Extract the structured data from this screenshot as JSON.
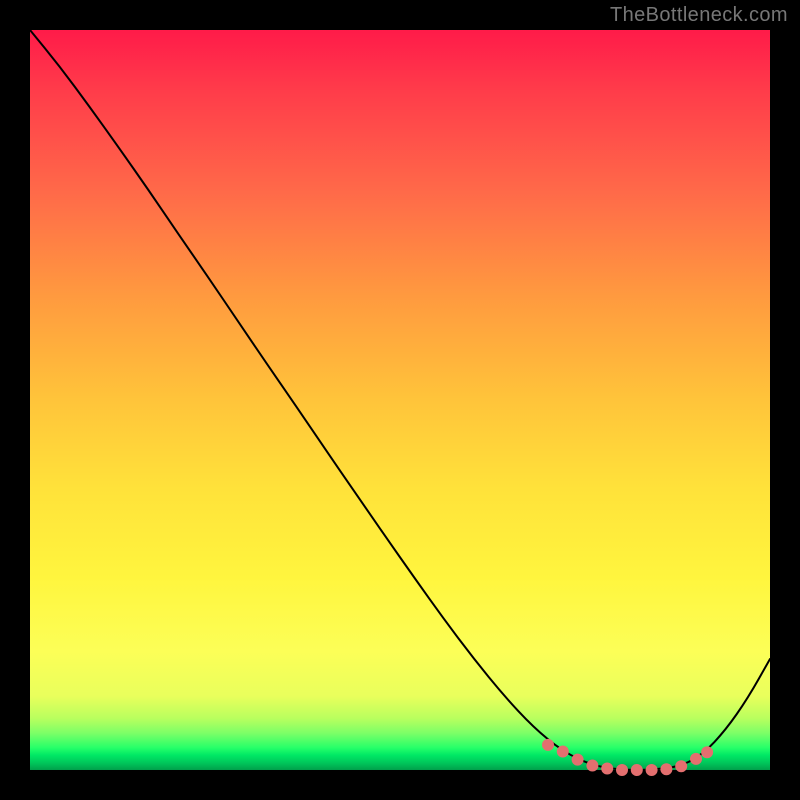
{
  "attribution": "TheBottleneck.com",
  "chart_data": {
    "type": "line",
    "title": "",
    "xlabel": "",
    "ylabel": "",
    "xlim": [
      0,
      100
    ],
    "ylim": [
      0,
      100
    ],
    "grid": false,
    "legend": false,
    "series": [
      {
        "name": "main-curve",
        "color": "#000000",
        "stroke_width": 2,
        "x": [
          0,
          4,
          8,
          12,
          16,
          20,
          24,
          28,
          32,
          36,
          40,
          44,
          48,
          52,
          56,
          60,
          64,
          68,
          72,
          76,
          80,
          84,
          88,
          91,
          94,
          97,
          100
        ],
        "y": [
          100,
          95.1,
          89.7,
          84.1,
          78.4,
          72.5,
          66.7,
          60.8,
          54.9,
          49.1,
          43.2,
          37.4,
          31.6,
          25.9,
          20.3,
          15.0,
          10.1,
          5.8,
          2.5,
          0.6,
          0.0,
          0.0,
          0.5,
          2.2,
          5.4,
          9.7,
          15.0
        ]
      },
      {
        "name": "valley-dots",
        "color": "#e36f6f",
        "marker_size": 6,
        "x": [
          70.0,
          72.0,
          74.0,
          76.0,
          78.0,
          80.0,
          82.0,
          84.0,
          86.0,
          88.0,
          90.0,
          91.5
        ],
        "y": [
          3.4,
          2.5,
          1.4,
          0.6,
          0.2,
          0.0,
          0.0,
          0.0,
          0.1,
          0.5,
          1.5,
          2.4
        ]
      }
    ]
  }
}
